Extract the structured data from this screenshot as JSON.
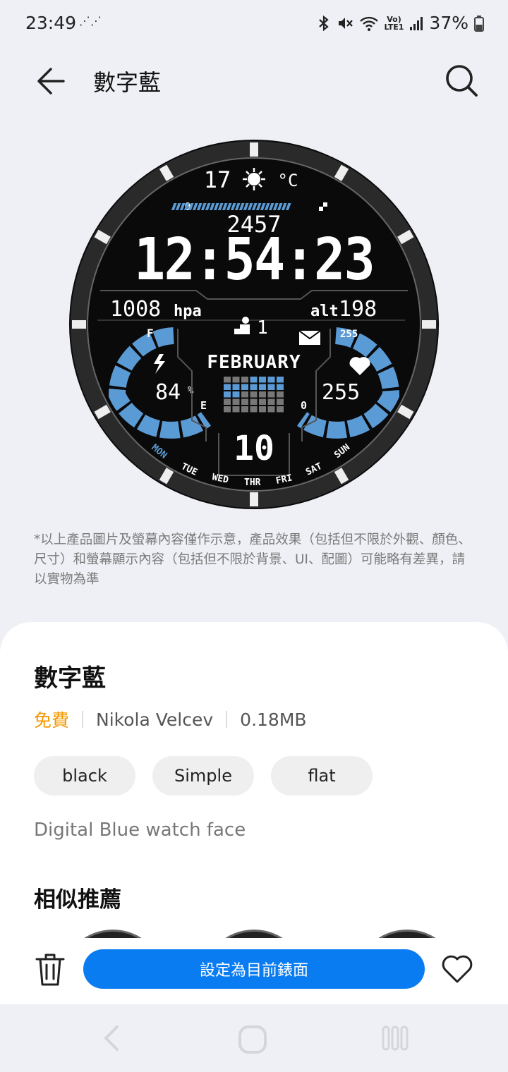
{
  "status_bar": {
    "time": "23:49",
    "activity": "⋰⋰",
    "lte": [
      "Vo)",
      "LTE1"
    ],
    "battery": "37%"
  },
  "header": {
    "title": "數字藍"
  },
  "watch_face": {
    "temperature": "17",
    "temp_unit": "°C",
    "progress_start": "0",
    "steps": "2457",
    "time": "12:54:23",
    "pressure": "1008",
    "pressure_unit": "hpa",
    "altitude_label": "alt",
    "altitude": "198",
    "notifications": "1",
    "month": "FEBRUARY",
    "day": "10",
    "battery_percent": "84",
    "battery_unit": "%",
    "battery_full": "F",
    "battery_empty": "E",
    "heart_rate": "255",
    "heart_max": "255",
    "heart_min": "0",
    "weekdays": [
      "MON",
      "TUE",
      "WED",
      "THR",
      "FRI",
      "SAT",
      "SUN"
    ]
  },
  "disclaimer": "*以上產品圖片及螢幕內容僅作示意，產品效果（包括但不限於外觀、顏色、尺寸）和螢幕顯示內容（包括但不限於背景、UI、配圖）可能略有差異，請以實物為準",
  "details": {
    "name": "數字藍",
    "price": "免費",
    "author": "Nikola Velcev",
    "size": "0.18MB",
    "tags": [
      "black",
      "Simple",
      "flat"
    ],
    "description": "Digital Blue watch face"
  },
  "similar_heading": "相似推薦",
  "actions": {
    "set_button": "設定為目前錶面"
  },
  "colors": {
    "accent": "#0a7cf2",
    "free": "#f39800",
    "watch_blue": "#5b9bd5"
  }
}
